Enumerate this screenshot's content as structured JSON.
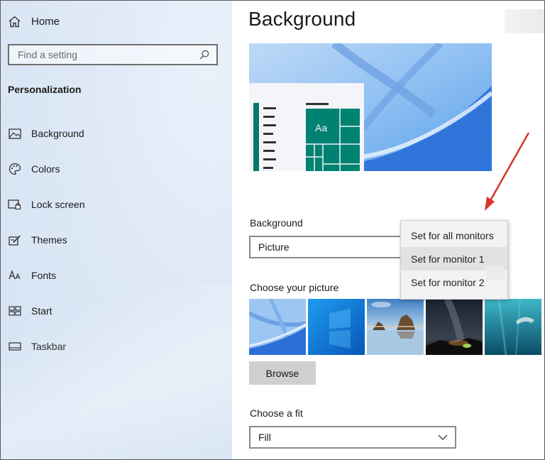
{
  "sidebar": {
    "home_label": "Home",
    "search_placeholder": "Find a setting",
    "section_title": "Personalization",
    "items": [
      {
        "label": "Background",
        "icon": "picture-icon"
      },
      {
        "label": "Colors",
        "icon": "palette-icon"
      },
      {
        "label": "Lock screen",
        "icon": "lock-screen-icon"
      },
      {
        "label": "Themes",
        "icon": "themes-icon"
      },
      {
        "label": "Fonts",
        "icon": "fonts-icon"
      },
      {
        "label": "Start",
        "icon": "start-icon"
      },
      {
        "label": "Taskbar",
        "icon": "taskbar-icon"
      }
    ]
  },
  "main": {
    "title": "Background",
    "preview": {
      "tile_text": "Aa"
    },
    "background_label": "Background",
    "background_value": "Picture",
    "choose_picture_label": "Choose your picture",
    "thumbnails": [
      "windows-bloom",
      "windows-light",
      "beach-rocks",
      "night-sky",
      "underwater"
    ],
    "browse_label": "Browse",
    "fit_label": "Choose a fit",
    "fit_value": "Fill"
  },
  "context_menu": {
    "items": [
      "Set for all monitors",
      "Set for monitor 1",
      "Set for monitor 2"
    ],
    "hovered_index": 1
  },
  "colors": {
    "accent_tile": "#008272",
    "arrow": "#d9342b"
  }
}
